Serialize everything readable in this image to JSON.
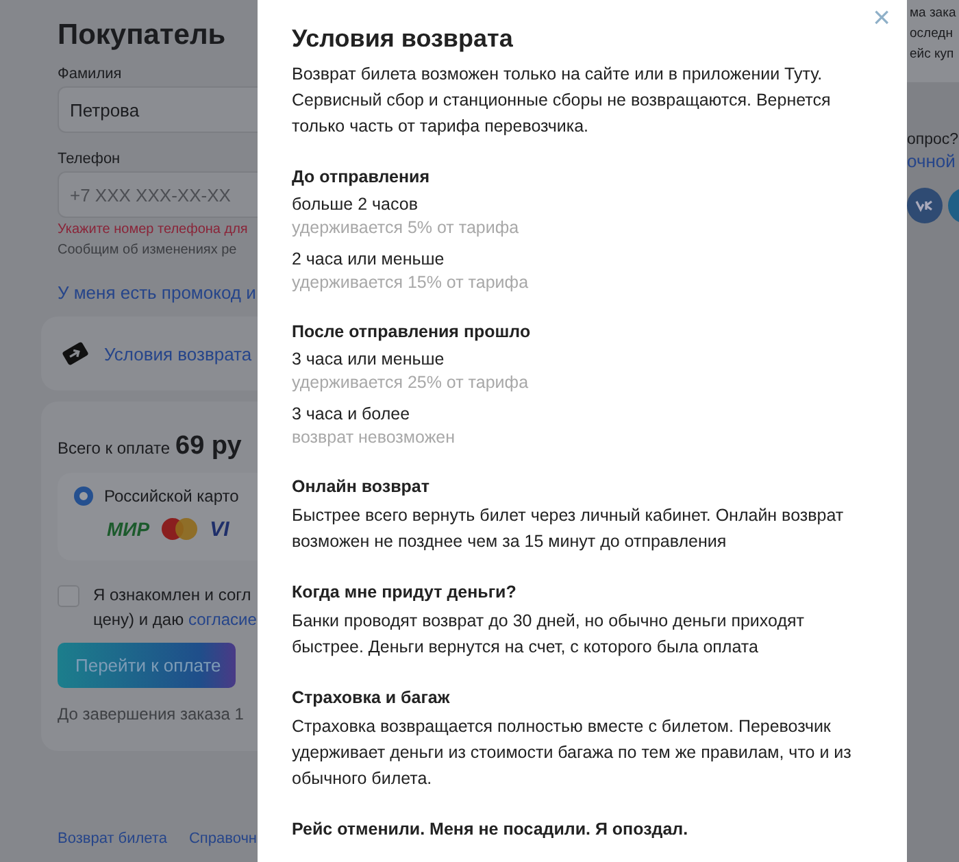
{
  "page": {
    "title": "Покупатель",
    "surname": {
      "label": "Фамилия",
      "value": "Петрова"
    },
    "phone": {
      "label": "Телефон",
      "placeholder": "+7 XXX XXX-XX-XX",
      "error": "Укажите номер телефона для",
      "hint": "Сообщим об изменениях ре"
    },
    "promo_link": "У меня есть промокод и",
    "return_link": "Условия возврата",
    "payment": {
      "total_label": "Всего к оплате",
      "total": "69 ру",
      "methods": [
        {
          "label": "Российской карто",
          "selected": true,
          "logos": [
            "МИР",
            "VI"
          ]
        }
      ],
      "agreement": {
        "checked": false,
        "line1": "Я ознакомлен и согл",
        "line2": "цену) и даю",
        "link": "согласие"
      },
      "pay_button": "Перейти к оплате",
      "timer": "До завершения заказа 1"
    },
    "footer_links": [
      "Возврат билета",
      "Справочн"
    ]
  },
  "side": {
    "lines": [
      "ма зака",
      "оследн",
      "ейс куп"
    ],
    "question": "опрос?",
    "link": "очной"
  },
  "modal": {
    "title": "Условия возврата",
    "close": "×",
    "intro": "Возврат билета возможен только на сайте или в приложении Туту. Сервисный сбор и станционные сборы не возвращаются. Вернется только часть от тарифа перевозчика.",
    "sections": [
      {
        "heading": "До отправления",
        "options": [
          {
            "title": "больше 2 часов",
            "note": "удерживается 5% от тарифа"
          },
          {
            "title": "2 часа или меньше",
            "note": "удерживается 15% от тарифа"
          }
        ]
      },
      {
        "heading": "После отправления прошло",
        "options": [
          {
            "title": "3 часа или меньше",
            "note": "удерживается 25% от тарифа"
          },
          {
            "title": "3 часа и более",
            "note": "возврат невозможен"
          }
        ]
      },
      {
        "heading": "Онлайн возврат",
        "text": "Быстрее всего вернуть билет через личный кабинет. Онлайн возврат возможен не позднее чем за 15 минут до отправления"
      },
      {
        "heading": "Когда мне придут деньги?",
        "text": "Банки проводят возврат до 30 дней, но обычно деньги приходят быстрее. Деньги вернутся на счет, с которого была оплата"
      },
      {
        "heading": "Страховка и багаж",
        "text": "Страховка возвращается полностью вместе с билетом. Перевозчик удерживает деньги из стоимости багажа по тем же правилам, что и из обычного билета."
      },
      {
        "heading": "Рейс отменили. Меня не посадили. Я опоздал."
      }
    ]
  }
}
